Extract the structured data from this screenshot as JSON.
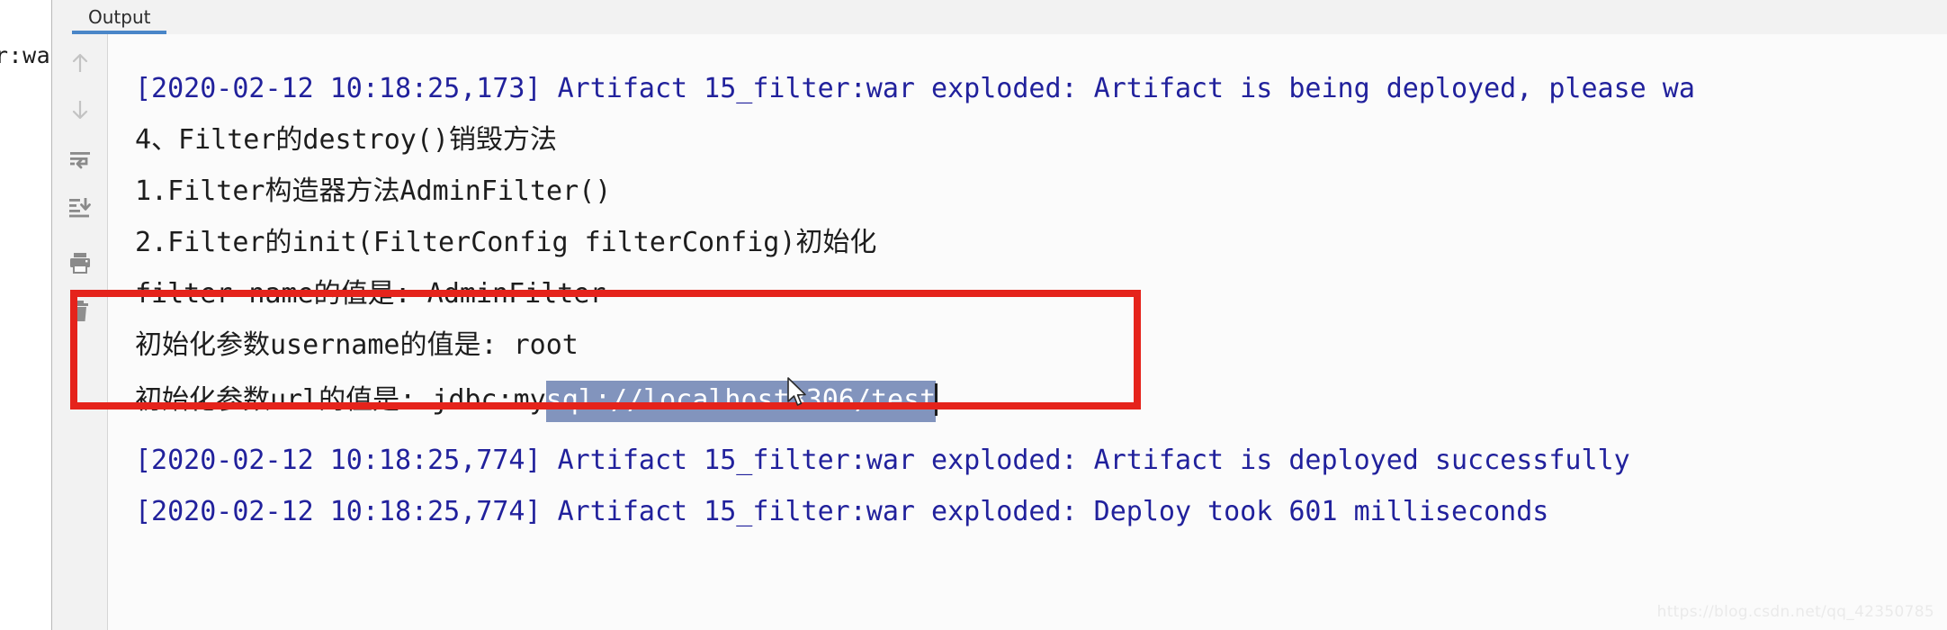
{
  "window": {
    "left_tree_fragment": "r:wa"
  },
  "tool_window": {
    "tabs": [
      {
        "label": "Output",
        "active": true
      }
    ]
  },
  "gutter": {
    "buttons": [
      {
        "name": "up-arrow-icon",
        "title": "Up"
      },
      {
        "name": "down-arrow-icon",
        "title": "Down"
      },
      {
        "name": "soft-wrap-icon",
        "title": "Soft-Wrap"
      },
      {
        "name": "scroll-to-end-icon",
        "title": "Scroll to End"
      },
      {
        "name": "print-icon",
        "title": "Print"
      },
      {
        "name": "trash-icon",
        "title": "Clear All"
      }
    ]
  },
  "console": {
    "lines": [
      {
        "kind": "stdout",
        "text": "[2020-02-12 10:18:25,173] Artifact 15_filter:war exploded: Artifact is being deployed, please wa"
      },
      {
        "kind": "app",
        "text": "4、Filter的destroy()销毁方法"
      },
      {
        "kind": "app",
        "text": "1.Filter构造器方法AdminFilter()"
      },
      {
        "kind": "app",
        "text": "2.Filter的init(FilterConfig filterConfig)初始化"
      },
      {
        "kind": "app",
        "text": "filter-name的值是: AdminFilter"
      },
      {
        "kind": "app",
        "text": "初始化参数username的值是: root"
      },
      {
        "kind": "app",
        "prefix": "初始化参数url的值是: jdbc:my",
        "selected": "sql://localhost3306/test",
        "has_caret": true
      },
      {
        "kind": "stdout",
        "text": "[2020-02-12 10:18:25,774] Artifact 15_filter:war exploded: Artifact is deployed successfully"
      },
      {
        "kind": "stdout",
        "text": "[2020-02-12 10:18:25,774] Artifact 15_filter:war exploded: Deploy took 601 milliseconds"
      }
    ]
  },
  "annotation": {
    "shape": "rectangle",
    "color": "#e5231b"
  },
  "selection": {
    "background": "#8294bd",
    "foreground": "#ffffff"
  },
  "colors": {
    "stdout_text": "#21219c",
    "app_text": "#1d1d1d",
    "tab_underline": "#4a86c8",
    "panel_background": "#f2f2f2",
    "console_background": "#fbfbfb"
  },
  "watermark": {
    "text": "https://blog.csdn.net/qq_42350785"
  }
}
